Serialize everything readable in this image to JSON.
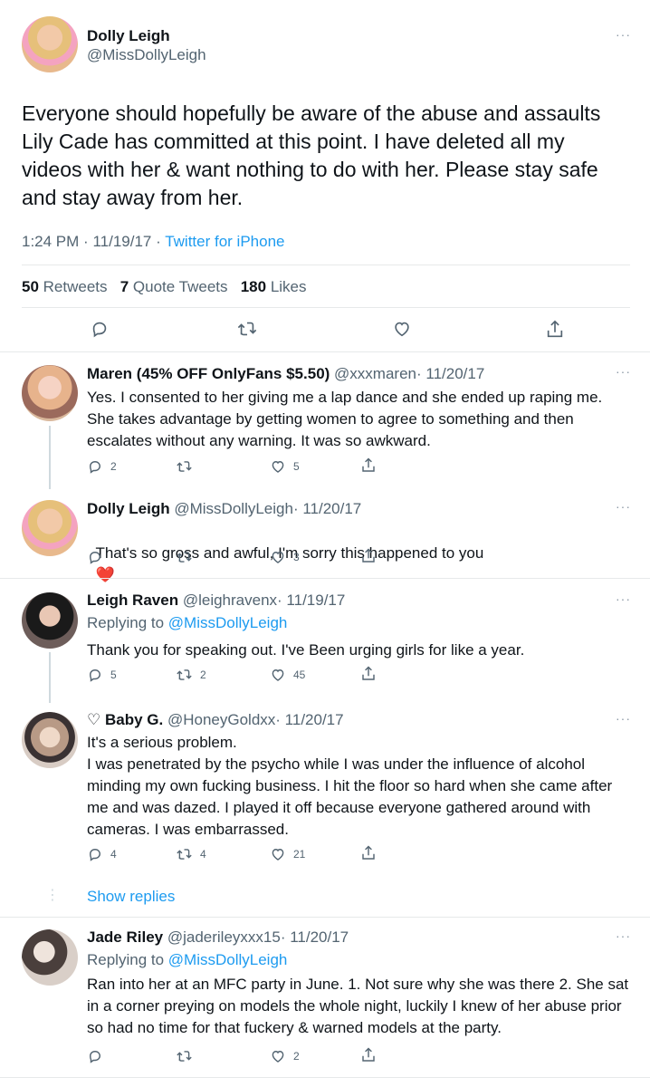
{
  "main_tweet": {
    "name": "Dolly Leigh",
    "handle": "@MissDollyLeigh",
    "text": "Everyone should hopefully be aware of the abuse and assaults Lily Cade has committed at this point. I have deleted all my videos with her & want nothing to do with her. Please stay safe and stay away from her.",
    "time": "1:24 PM",
    "date": "11/19/17",
    "separator": "·",
    "source": "Twitter for iPhone",
    "retweets_count": "50",
    "retweets_label": "Retweets",
    "quotes_count": "7",
    "quotes_label": "Quote Tweets",
    "likes_count": "180",
    "likes_label": "Likes",
    "more": "···"
  },
  "replies": [
    {
      "name": "Maren (45% OFF OnlyFans $5.50)",
      "handle": "@xxxmaren",
      "date": "· 11/20/17",
      "text": "Yes. I consented to her giving me a lap dance and she ended up raping me. She takes advantage by getting women to agree to something and then escalates without any warning. It was so awkward.",
      "reply_count": "2",
      "retweet_count": "",
      "like_count": "5",
      "more": "···"
    },
    {
      "name": "Dolly Leigh",
      "handle": "@MissDollyLeigh",
      "date": "· 11/20/17",
      "text": "That's so gross and awful, I'm sorry this happened to you",
      "emoji": "❤️",
      "reply_count": "",
      "retweet_count": "",
      "like_count": "3",
      "more": "···"
    },
    {
      "name": "Leigh Raven",
      "handle": "@leighravenx",
      "date": "· 11/19/17",
      "replying_label": "Replying to",
      "replying_to": "@MissDollyLeigh",
      "text": "Thank you for speaking out. I've Been urging girls for like a year.",
      "reply_count": "5",
      "retweet_count": "2",
      "like_count": "45",
      "more": "···"
    },
    {
      "name_prefix": "♡",
      "name": "Baby G.",
      "handle": "@HoneyGoldxx",
      "date": "· 11/20/17",
      "text": "It's a serious problem.\nI was penetrated by the psycho while I was under the influence of alcohol minding my own fucking business. I hit the floor so hard when she came after me and was dazed. I played it off because everyone gathered around with cameras. I was embarrassed.",
      "reply_count": "4",
      "retweet_count": "4",
      "like_count": "21",
      "more": "···"
    },
    {
      "name": "Jade Riley",
      "handle": "@jaderileyxxx15",
      "date": "· 11/20/17",
      "replying_label": "Replying to",
      "replying_to": "@MissDollyLeigh",
      "text": "Ran into her at an MFC party in June. 1. Not sure why she was there 2. She sat in a corner preying on models the whole night, luckily I knew of her abuse prior so had no time for that fuckery & warned models at the party.",
      "reply_count": "",
      "retweet_count": "",
      "like_count": "2",
      "more": "···"
    }
  ],
  "show_replies": "Show replies",
  "show_replies_dots": "⋮",
  "colors": {
    "link": "#1d9bf0",
    "muted": "#536471",
    "text": "#0f1419",
    "divider": "#e7e9ea",
    "heart": "#f91880"
  }
}
